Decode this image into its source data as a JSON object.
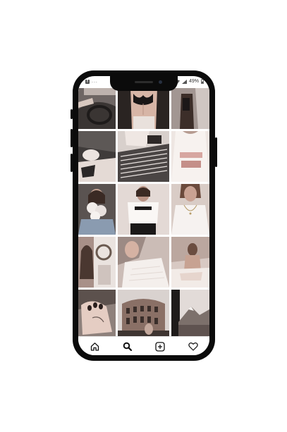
{
  "status_bar": {
    "notification_icon": "f",
    "overflow": "...",
    "battery": "49%"
  },
  "tab_bar": {
    "items": [
      {
        "icon": "home-icon"
      },
      {
        "icon": "search-icon"
      },
      {
        "icon": "add-post-icon"
      },
      {
        "icon": "heart-icon"
      }
    ]
  },
  "grid": {
    "columns": 3,
    "rows": 5,
    "tile_count": 15
  },
  "colors": {
    "phone_frame": "#0b0b0b",
    "screen_bg": "#ffffff",
    "tile_palette": [
      "#3b3433",
      "#e9dcd6",
      "#a89893",
      "#6b5a55",
      "#f1e8e4"
    ]
  }
}
